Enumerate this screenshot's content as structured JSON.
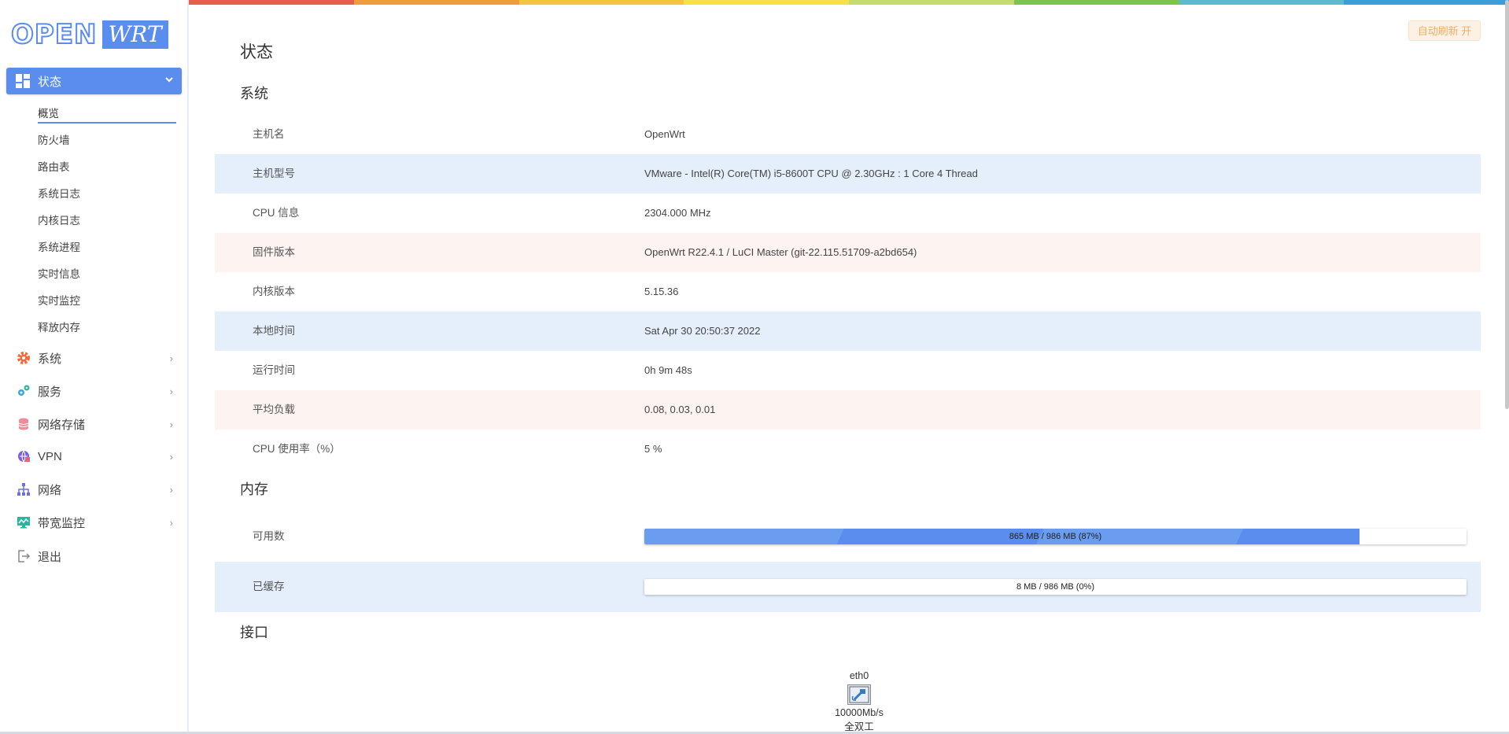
{
  "logo": {
    "part1": "OPEN",
    "part2": "WRT"
  },
  "auto_refresh": "自动刷新 开",
  "sidebar": {
    "active_menu": {
      "label": "状态",
      "icon": "dashboard-icon"
    },
    "submenu": [
      "概览",
      "防火墙",
      "路由表",
      "系统日志",
      "内核日志",
      "系统进程",
      "实时信息",
      "实时监控",
      "释放内存"
    ],
    "menus": [
      {
        "label": "系统",
        "icon": "gear-icon",
        "color": "#f26a3c"
      },
      {
        "label": "服务",
        "icon": "services-icon",
        "color": "#3fa6d9"
      },
      {
        "label": "网络存储",
        "icon": "storage-icon",
        "color": "#f08b9a"
      },
      {
        "label": "VPN",
        "icon": "vpn-icon",
        "color": "#7c5ce0"
      },
      {
        "label": "网络",
        "icon": "network-icon",
        "color": "#6a72d8"
      },
      {
        "label": "带宽监控",
        "icon": "bandwidth-monitor-icon",
        "color": "#2bb5a0"
      },
      {
        "label": "退出",
        "icon": "logout-icon",
        "color": "#888888"
      }
    ]
  },
  "page_title": "状态",
  "system": {
    "heading": "系统",
    "rows": [
      {
        "label": "主机名",
        "value": "OpenWrt"
      },
      {
        "label": "主机型号",
        "value": "VMware - Intel(R) Core(TM) i5-8600T CPU @ 2.30GHz : 1 Core 4 Thread"
      },
      {
        "label": "CPU 信息",
        "value": "2304.000 MHz"
      },
      {
        "label": "固件版本",
        "value": "OpenWrt R22.4.1 / LuCI Master (git-22.115.51709-a2bd654)"
      },
      {
        "label": "内核版本",
        "value": "5.15.36"
      },
      {
        "label": "本地时间",
        "value": "Sat Apr 30 20:50:37 2022"
      },
      {
        "label": "运行时间",
        "value": "0h 9m 48s"
      },
      {
        "label": "平均负载",
        "value": "0.08, 0.03, 0.01"
      },
      {
        "label": "CPU 使用率（%）",
        "value": "5 %"
      }
    ]
  },
  "memory": {
    "heading": "内存",
    "rows": [
      {
        "label": "可用数",
        "text": "865 MB / 986 MB (87%)",
        "fraction": 0.87
      },
      {
        "label": "已缓存",
        "text": "8 MB / 986 MB (0%)",
        "fraction": 0.0
      }
    ]
  },
  "interfaces": {
    "heading": "接口",
    "items": [
      {
        "name": "eth0",
        "speed": "10000Mb/s",
        "duplex": "全双工"
      }
    ]
  },
  "colors": {
    "accent": "#5b8def",
    "rainbow": [
      "#e4604b",
      "#f19c3c",
      "#f6c443",
      "#f4e04a",
      "#c6dc6c",
      "#7cc44e",
      "#5bbcca",
      "#3b9ed8"
    ]
  }
}
